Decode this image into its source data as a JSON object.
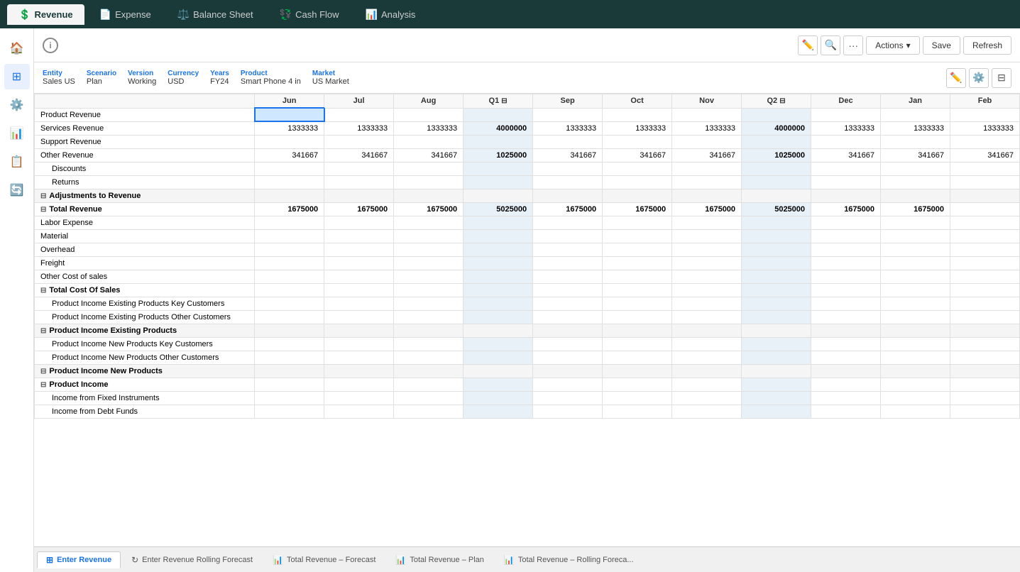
{
  "topNav": {
    "tabs": [
      {
        "id": "revenue",
        "label": "Revenue",
        "icon": "💲",
        "active": true
      },
      {
        "id": "expense",
        "label": "Expense",
        "icon": "📄",
        "active": false
      },
      {
        "id": "balance-sheet",
        "label": "Balance Sheet",
        "icon": "⚖️",
        "active": false
      },
      {
        "id": "cash-flow",
        "label": "Cash Flow",
        "icon": "💱",
        "active": false
      },
      {
        "id": "analysis",
        "label": "Analysis",
        "icon": "📊",
        "active": false
      }
    ]
  },
  "toolbar": {
    "infoLabel": "i",
    "editIcon": "✏️",
    "settingsIcon": "⚙️",
    "layoutIcon": "⊟",
    "actionsLabel": "Actions",
    "saveLabel": "Save",
    "refreshLabel": "Refresh",
    "dotsLabel": "···"
  },
  "filters": {
    "entity": {
      "label": "Entity",
      "value": "Sales US"
    },
    "scenario": {
      "label": "Scenario",
      "value": "Plan"
    },
    "version": {
      "label": "Version",
      "value": "Working"
    },
    "currency": {
      "label": "Currency",
      "value": "USD"
    },
    "years": {
      "label": "Years",
      "value": "FY24"
    },
    "product": {
      "label": "Product",
      "value": "Smart Phone 4 in"
    },
    "market": {
      "label": "Market",
      "value": "US Market"
    }
  },
  "columns": [
    {
      "id": "label",
      "header": "",
      "isLabel": true
    },
    {
      "id": "jun",
      "header": "Jun"
    },
    {
      "id": "jul",
      "header": "Jul"
    },
    {
      "id": "aug",
      "header": "Aug"
    },
    {
      "id": "q1",
      "header": "Q1",
      "isQuarter": true
    },
    {
      "id": "sep",
      "header": "Sep"
    },
    {
      "id": "oct",
      "header": "Oct"
    },
    {
      "id": "nov",
      "header": "Nov"
    },
    {
      "id": "q2",
      "header": "Q2",
      "isQuarter": true
    },
    {
      "id": "dec",
      "header": "Dec"
    },
    {
      "id": "jan",
      "header": "Jan"
    },
    {
      "id": "feb",
      "header": "Feb"
    }
  ],
  "rows": [
    {
      "id": "product-revenue",
      "label": "Product Revenue",
      "indent": 0,
      "values": {
        "jun": "",
        "jul": "",
        "aug": "",
        "q1": "",
        "sep": "",
        "oct": "",
        "nov": "",
        "q2": "",
        "dec": "",
        "jan": "",
        "feb": ""
      },
      "selected": true
    },
    {
      "id": "services-revenue",
      "label": "Services Revenue",
      "indent": 0,
      "values": {
        "jun": "1333333",
        "jul": "1333333",
        "aug": "1333333",
        "q1": "4000000",
        "sep": "1333333",
        "oct": "1333333",
        "nov": "1333333",
        "q2": "4000000",
        "dec": "1333333",
        "jan": "1333333",
        "feb": "1333333"
      }
    },
    {
      "id": "support-revenue",
      "label": "Support Revenue",
      "indent": 0,
      "values": {
        "jun": "",
        "jul": "",
        "aug": "",
        "q1": "",
        "sep": "",
        "oct": "",
        "nov": "",
        "q2": "",
        "dec": "",
        "jan": "",
        "feb": ""
      }
    },
    {
      "id": "other-revenue",
      "label": "Other Revenue",
      "indent": 0,
      "values": {
        "jun": "341667",
        "jul": "341667",
        "aug": "341667",
        "q1": "1025000",
        "sep": "341667",
        "oct": "341667",
        "nov": "341667",
        "q2": "1025000",
        "dec": "341667",
        "jan": "341667",
        "feb": "341667"
      }
    },
    {
      "id": "discounts",
      "label": "Discounts",
      "indent": 1,
      "values": {
        "jun": "",
        "jul": "",
        "aug": "",
        "q1": "",
        "sep": "",
        "oct": "",
        "nov": "",
        "q2": "",
        "dec": "",
        "jan": "",
        "feb": ""
      }
    },
    {
      "id": "returns",
      "label": "Returns",
      "indent": 1,
      "values": {
        "jun": "",
        "jul": "",
        "aug": "",
        "q1": "",
        "sep": "",
        "oct": "",
        "nov": "",
        "q2": "",
        "dec": "",
        "jan": "",
        "feb": ""
      }
    },
    {
      "id": "adjustments-to-revenue",
      "label": "Adjustments to Revenue",
      "indent": 0,
      "isSectionCollapsible": true,
      "expanded": false,
      "values": {
        "jun": "",
        "jul": "",
        "aug": "",
        "q1": "",
        "sep": "",
        "oct": "",
        "nov": "",
        "q2": "",
        "dec": "",
        "jan": "",
        "feb": ""
      }
    },
    {
      "id": "total-revenue",
      "label": "Total Revenue",
      "indent": 0,
      "isBold": true,
      "isTotal": true,
      "expanded": true,
      "values": {
        "jun": "1675000",
        "jul": "1675000",
        "aug": "1675000",
        "q1": "5025000",
        "sep": "1675000",
        "oct": "1675000",
        "nov": "1675000",
        "q2": "5025000",
        "dec": "1675000",
        "jan": "1675000",
        "feb": ""
      }
    },
    {
      "id": "labor-expense",
      "label": "Labor Expense",
      "indent": 0,
      "values": {
        "jun": "",
        "jul": "",
        "aug": "",
        "q1": "",
        "sep": "",
        "oct": "",
        "nov": "",
        "q2": "",
        "dec": "",
        "jan": "",
        "feb": ""
      }
    },
    {
      "id": "material",
      "label": "Material",
      "indent": 0,
      "values": {
        "jun": "",
        "jul": "",
        "aug": "",
        "q1": "",
        "sep": "",
        "oct": "",
        "nov": "",
        "q2": "",
        "dec": "",
        "jan": "",
        "feb": ""
      }
    },
    {
      "id": "overhead",
      "label": "Overhead",
      "indent": 0,
      "values": {
        "jun": "",
        "jul": "",
        "aug": "",
        "q1": "",
        "sep": "",
        "oct": "",
        "nov": "",
        "q2": "",
        "dec": "",
        "jan": "",
        "feb": ""
      }
    },
    {
      "id": "freight",
      "label": "Freight",
      "indent": 0,
      "values": {
        "jun": "",
        "jul": "",
        "aug": "",
        "q1": "",
        "sep": "",
        "oct": "",
        "nov": "",
        "q2": "",
        "dec": "",
        "jan": "",
        "feb": ""
      }
    },
    {
      "id": "other-cost-of-sales",
      "label": "Other Cost of sales",
      "indent": 0,
      "values": {
        "jun": "",
        "jul": "",
        "aug": "",
        "q1": "",
        "sep": "",
        "oct": "",
        "nov": "",
        "q2": "",
        "dec": "",
        "jan": "",
        "feb": ""
      }
    },
    {
      "id": "total-cost-of-sales",
      "label": "Total Cost Of Sales",
      "indent": 0,
      "isBold": true,
      "isTotal": true,
      "expanded": true,
      "values": {
        "jun": "",
        "jul": "",
        "aug": "",
        "q1": "",
        "sep": "",
        "oct": "",
        "nov": "",
        "q2": "",
        "dec": "",
        "jan": "",
        "feb": ""
      }
    },
    {
      "id": "product-income-existing-key",
      "label": "Product Income Existing Products Key Customers",
      "indent": 1,
      "values": {
        "jun": "",
        "jul": "",
        "aug": "",
        "q1": "",
        "sep": "",
        "oct": "",
        "nov": "",
        "q2": "",
        "dec": "",
        "jan": "",
        "feb": ""
      }
    },
    {
      "id": "product-income-existing-other",
      "label": "Product Income Existing Products Other Customers",
      "indent": 1,
      "values": {
        "jun": "",
        "jul": "",
        "aug": "",
        "q1": "",
        "sep": "",
        "oct": "",
        "nov": "",
        "q2": "",
        "dec": "",
        "jan": "",
        "feb": ""
      }
    },
    {
      "id": "product-income-existing-products",
      "label": "Product Income Existing Products",
      "indent": 0,
      "isBold": true,
      "isSectionCollapsible": true,
      "expanded": false,
      "values": {
        "jun": "",
        "jul": "",
        "aug": "",
        "q1": "",
        "sep": "",
        "oct": "",
        "nov": "",
        "q2": "",
        "dec": "",
        "jan": "",
        "feb": ""
      }
    },
    {
      "id": "product-income-new-key",
      "label": "Product Income New Products Key Customers",
      "indent": 1,
      "values": {
        "jun": "",
        "jul": "",
        "aug": "",
        "q1": "",
        "sep": "",
        "oct": "",
        "nov": "",
        "q2": "",
        "dec": "",
        "jan": "",
        "feb": ""
      }
    },
    {
      "id": "product-income-new-other",
      "label": "Product Income New Products Other Customers",
      "indent": 1,
      "values": {
        "jun": "",
        "jul": "",
        "aug": "",
        "q1": "",
        "sep": "",
        "oct": "",
        "nov": "",
        "q2": "",
        "dec": "",
        "jan": "",
        "feb": ""
      }
    },
    {
      "id": "product-income-new-products",
      "label": "Product Income New Products",
      "indent": 0,
      "isBold": true,
      "isSectionCollapsible": true,
      "expanded": false,
      "values": {
        "jun": "",
        "jul": "",
        "aug": "",
        "q1": "",
        "sep": "",
        "oct": "",
        "nov": "",
        "q2": "",
        "dec": "",
        "jan": "",
        "feb": ""
      }
    },
    {
      "id": "product-income",
      "label": "Product Income",
      "indent": 0,
      "isBold": true,
      "isTotal": true,
      "expanded": true,
      "values": {
        "jun": "",
        "jul": "",
        "aug": "",
        "q1": "",
        "sep": "",
        "oct": "",
        "nov": "",
        "q2": "",
        "dec": "",
        "jan": "",
        "feb": ""
      }
    },
    {
      "id": "income-fixed",
      "label": "Income from Fixed Instruments",
      "indent": 1,
      "values": {
        "jun": "",
        "jul": "",
        "aug": "",
        "q1": "",
        "sep": "",
        "oct": "",
        "nov": "",
        "q2": "",
        "dec": "",
        "jan": "",
        "feb": ""
      }
    },
    {
      "id": "income-debt",
      "label": "Income from Debt Funds",
      "indent": 1,
      "values": {
        "jun": "",
        "jul": "",
        "aug": "",
        "q1": "",
        "sep": "",
        "oct": "",
        "nov": "",
        "q2": "",
        "dec": "",
        "jan": "",
        "feb": ""
      }
    }
  ],
  "bottomTabs": [
    {
      "id": "enter-revenue",
      "label": "Enter Revenue",
      "icon": "⊞",
      "active": true
    },
    {
      "id": "enter-revenue-rolling",
      "label": "Enter Revenue Rolling Forecast",
      "icon": "↻",
      "active": false
    },
    {
      "id": "total-revenue-forecast",
      "label": "Total Revenue – Forecast",
      "icon": "📊",
      "active": false
    },
    {
      "id": "total-revenue-plan",
      "label": "Total Revenue – Plan",
      "icon": "📊",
      "active": false
    },
    {
      "id": "total-revenue-rolling",
      "label": "Total Revenue – Rolling Foreca...",
      "icon": "📊",
      "active": false
    }
  ]
}
